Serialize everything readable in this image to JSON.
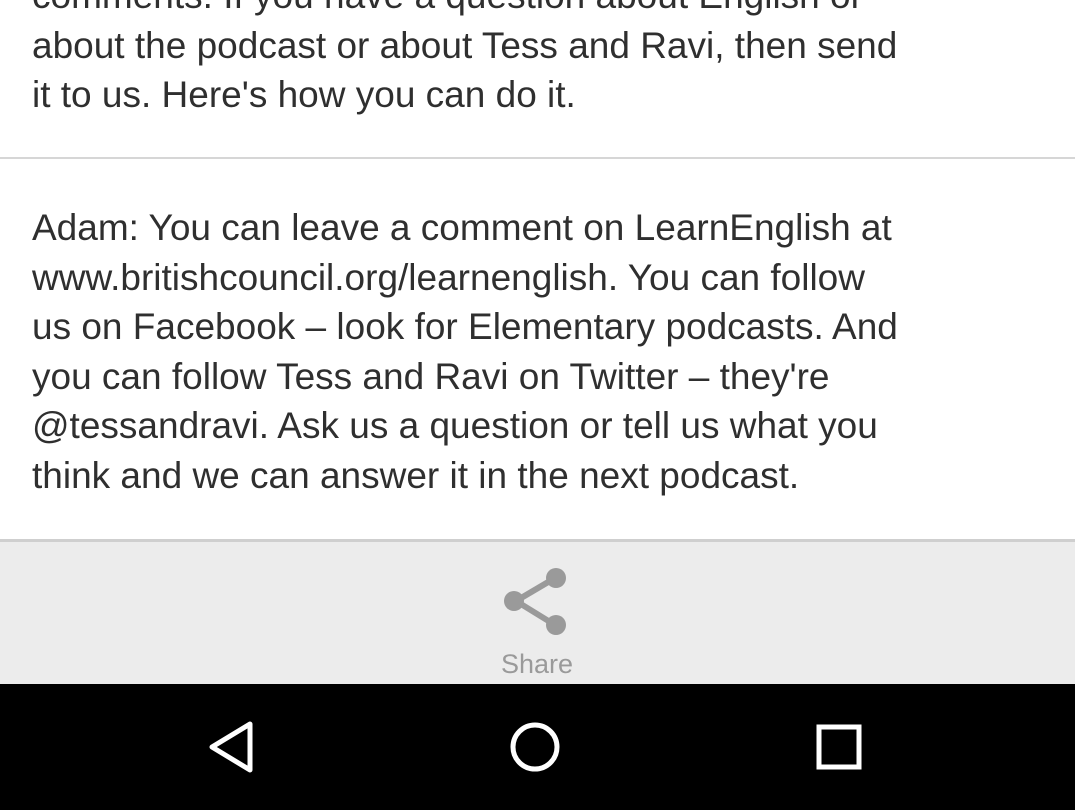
{
  "article": {
    "paragraph_1": "comments. If you have a question about English or\nabout the podcast or about Tess and Ravi, then send\nit to us. Here's how you can do it.",
    "paragraph_2": "Adam: You can leave a comment on LearnEnglish at\nwww.britishcouncil.org/learnenglish. You can follow\nus on Facebook – look for Elementary podcasts. And\nyou can follow Tess and Ravi on Twitter – they're\n@tessandravi. Ask us a question or tell us what you\nthink and we can answer it in the next podcast."
  },
  "share_bar": {
    "label": "Share",
    "icon": "share-icon"
  },
  "nav_bar": {
    "back_icon": "back-triangle-icon",
    "home_icon": "home-circle-icon",
    "recents_icon": "recents-square-icon"
  },
  "colors": {
    "text": "#2f2f2f",
    "share_bar_bg": "#ececec",
    "share_icon": "#9a9a9a",
    "nav_bar_bg": "#000000",
    "nav_icon": "#ffffff"
  }
}
